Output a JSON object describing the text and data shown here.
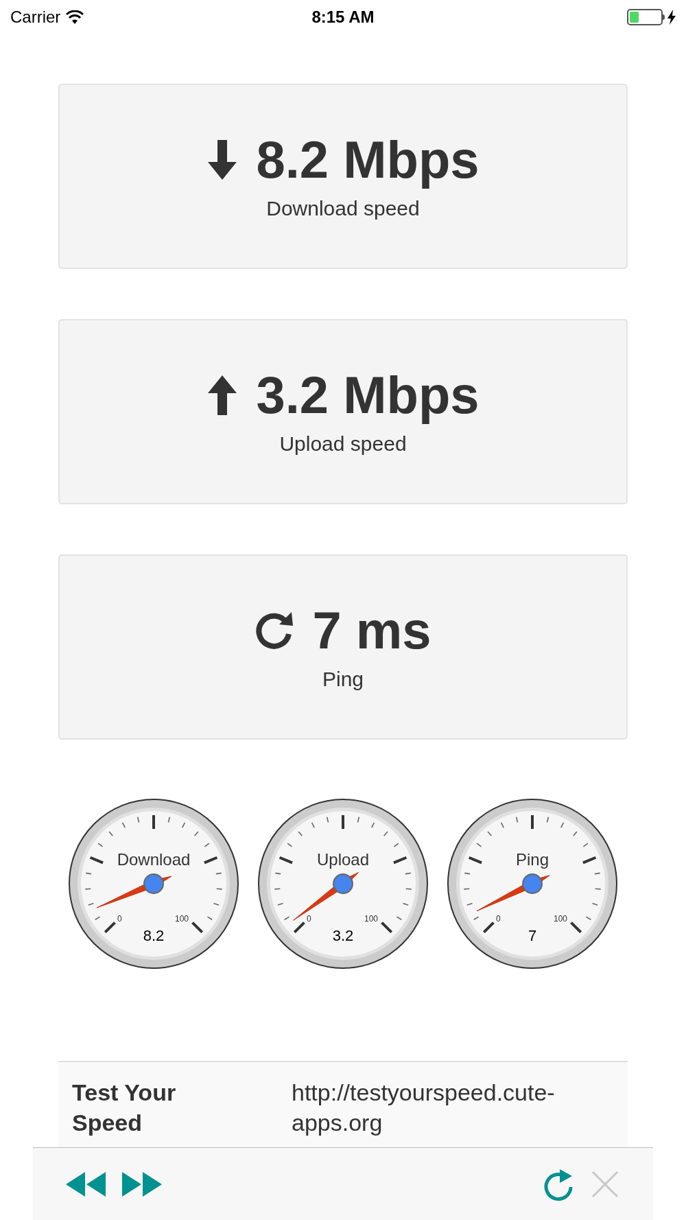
{
  "status_bar": {
    "carrier": "Carrier",
    "time": "8:15 AM",
    "charging": true
  },
  "cards": [
    {
      "kind": "download",
      "value": "8.2 Mbps",
      "label": "Download speed"
    },
    {
      "kind": "upload",
      "value": "3.2 Mbps",
      "label": "Upload speed"
    },
    {
      "kind": "ping",
      "value": "7 ms",
      "label": "Ping"
    }
  ],
  "gauges": [
    {
      "label": "Download",
      "min": "0",
      "max": "100",
      "reading": "8.2"
    },
    {
      "label": "Upload",
      "min": "0",
      "max": "100",
      "reading": "3.2"
    },
    {
      "label": "Ping",
      "min": "0",
      "max": "100",
      "reading": "7"
    }
  ],
  "info_table": {
    "rows": [
      {
        "name": "Test Your Speed",
        "value": "http://testyourspeed.cute-apps.org"
      }
    ]
  },
  "toolbar": {
    "back_enabled": true,
    "forward_enabled": true,
    "reload_enabled": true,
    "stop_enabled": false
  }
}
